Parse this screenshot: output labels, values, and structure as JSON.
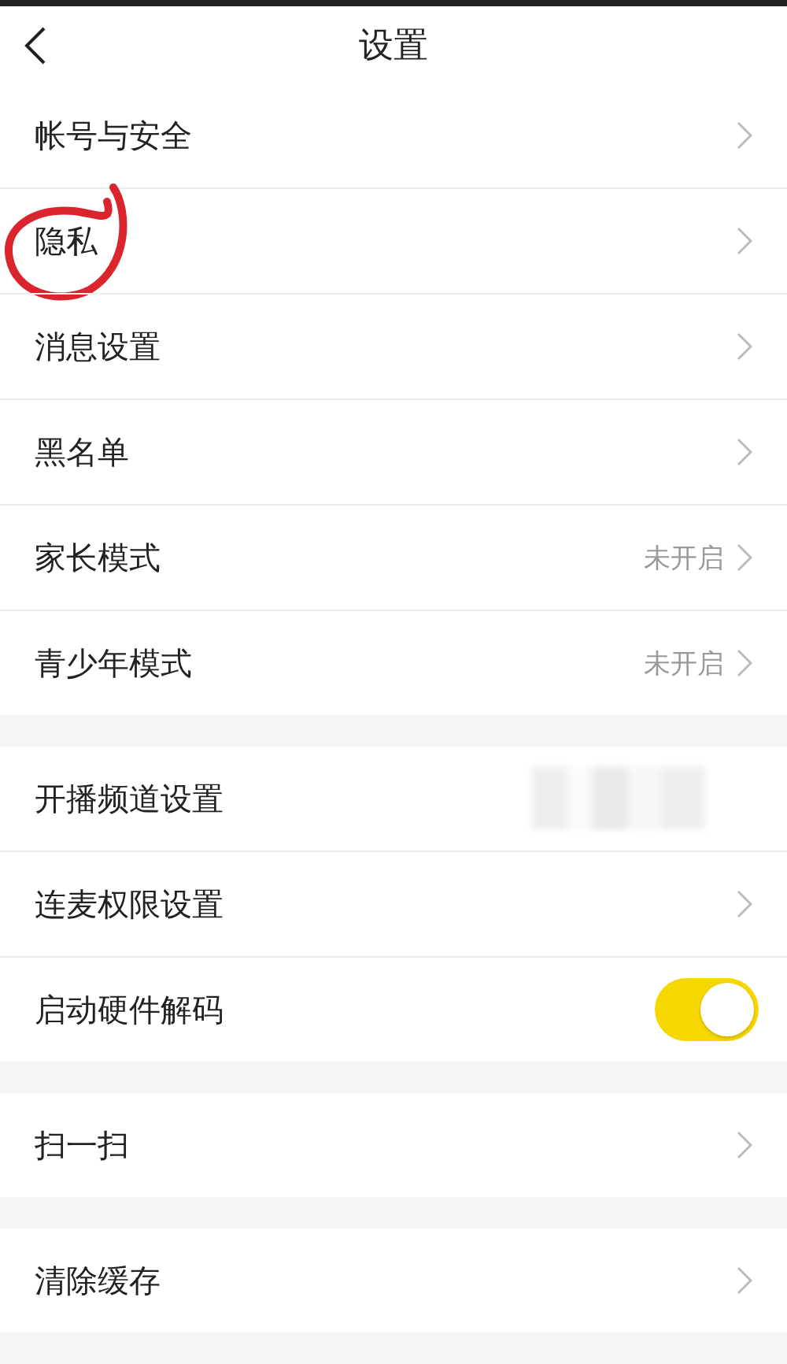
{
  "header": {
    "title": "设置"
  },
  "groups": [
    {
      "items": [
        {
          "kind": "link",
          "label": "帐号与安全"
        },
        {
          "kind": "link",
          "label": "隐私",
          "circled": true
        },
        {
          "kind": "link",
          "label": "消息设置"
        },
        {
          "kind": "link",
          "label": "黑名单"
        },
        {
          "kind": "value",
          "label": "家长模式",
          "value": "未开启"
        },
        {
          "kind": "value",
          "label": "青少年模式",
          "value": "未开启"
        }
      ]
    },
    {
      "items": [
        {
          "kind": "redacted",
          "label": "开播频道设置"
        },
        {
          "kind": "link",
          "label": "连麦权限设置"
        },
        {
          "kind": "toggle",
          "label": "启动硬件解码",
          "on": true
        }
      ]
    },
    {
      "items": [
        {
          "kind": "link",
          "label": "扫一扫"
        }
      ]
    },
    {
      "items": [
        {
          "kind": "link",
          "label": "清除缓存"
        }
      ]
    }
  ]
}
